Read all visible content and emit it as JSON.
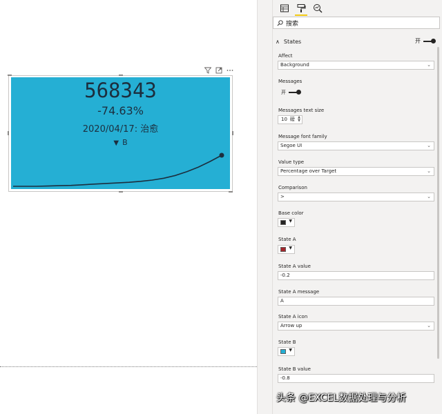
{
  "kpi": {
    "value": "568343",
    "percent": "-74.63%",
    "date_label": "2020/04/17: 治愈",
    "state_arrow": "▼",
    "state_label": "B",
    "background_color": "#25afd4",
    "text_color": "#1c2e3e"
  },
  "visual_header_icons": [
    "filter-icon",
    "focus-mode-icon",
    "more-options-icon"
  ],
  "pane": {
    "tabs": [
      "fields-icon",
      "format-paint-icon",
      "analytics-icon"
    ],
    "search_placeholder": "搜索",
    "section_title": "States",
    "section_toggle_label": "开",
    "affect": {
      "label": "Affect",
      "value": "Background"
    },
    "messages": {
      "label": "Messages",
      "toggle_label": "开"
    },
    "messages_text_size": {
      "label": "Messages text size",
      "value": "10",
      "unit": "磅"
    },
    "message_font_family": {
      "label": "Message font family",
      "value": "Segoe UI"
    },
    "value_type": {
      "label": "Value type",
      "value": "Percentage over Target"
    },
    "comparison": {
      "label": "Comparison",
      "value": ">"
    },
    "base_color": {
      "label": "Base color",
      "color": "#252423"
    },
    "state_a": {
      "label": "State A",
      "color": "#a4262c"
    },
    "state_a_value": {
      "label": "State A value",
      "value": "-0.2"
    },
    "state_a_message": {
      "label": "State A message",
      "value": "A"
    },
    "state_a_icon": {
      "label": "State A icon",
      "value": "Arrow up"
    },
    "state_b": {
      "label": "State B",
      "color": "#25afd4"
    },
    "state_b_value": {
      "label": "State B value",
      "value": "-0.8"
    }
  },
  "watermark": "头条 @EXCEL数据处理与分析",
  "sparkline_trend": [
    0.0,
    0.0,
    0.0,
    0.01,
    0.02,
    0.03,
    0.05,
    0.07,
    0.09,
    0.11,
    0.13,
    0.16,
    0.2,
    0.26,
    0.35,
    0.47,
    0.62,
    0.8,
    1.0
  ]
}
